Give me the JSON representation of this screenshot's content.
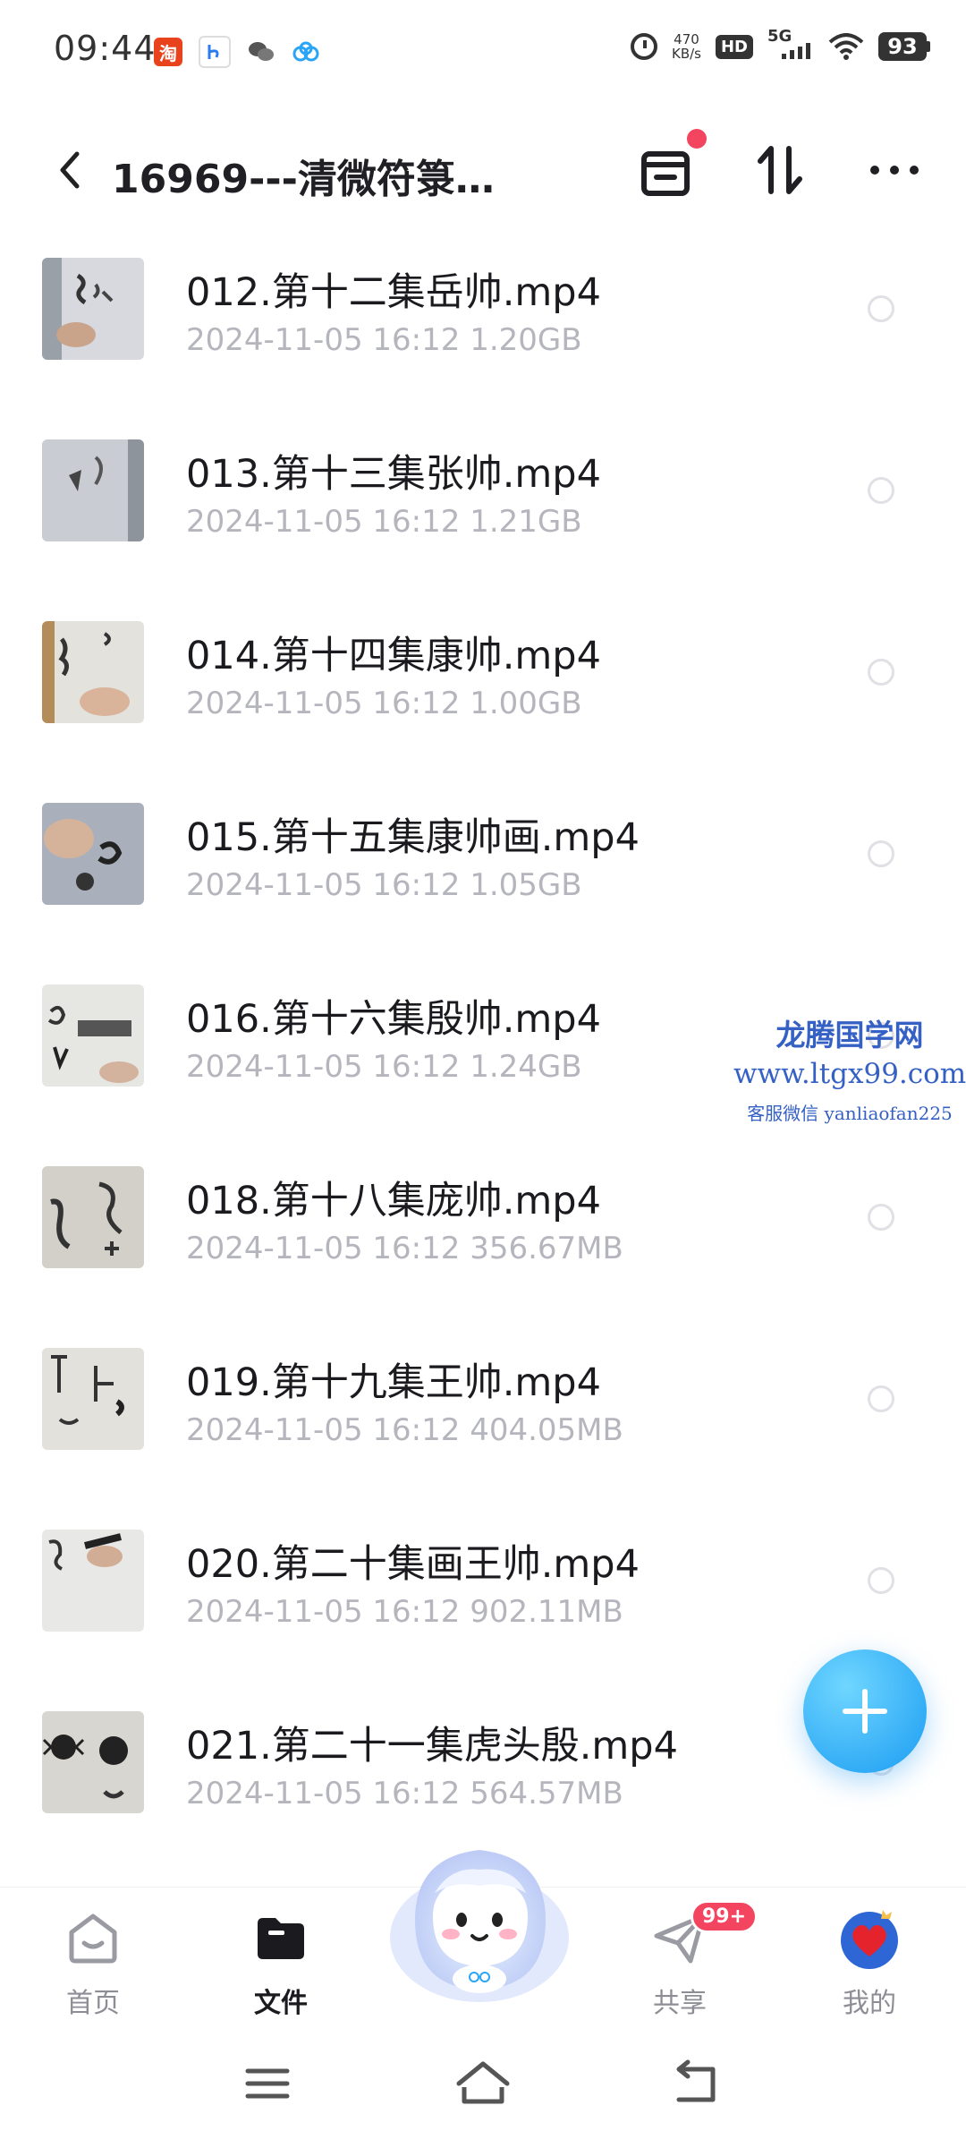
{
  "status_bar": {
    "time": "09:44",
    "net_speed_value": "470",
    "net_speed_unit": "KB/s",
    "hd_label": "HD",
    "network_label": "5G",
    "battery_level": "93",
    "app_icons": [
      "taobao-icon",
      "app-b-icon",
      "wechat-icon",
      "baidu-cloud-icon"
    ]
  },
  "header": {
    "title": "16969---清微符箓…",
    "notification_dot_color": "#f3455f"
  },
  "files": [
    {
      "name": "012.第十二集岳帅.mp4",
      "date": "2024-11-05",
      "time": "16:12",
      "size": "1.20GB"
    },
    {
      "name": "013.第十三集张帅.mp4",
      "date": "2024-11-05",
      "time": "16:12",
      "size": "1.21GB"
    },
    {
      "name": "014.第十四集康帅.mp4",
      "date": "2024-11-05",
      "time": "16:12",
      "size": "1.00GB"
    },
    {
      "name": "015.第十五集康帅画.mp4",
      "date": "2024-11-05",
      "time": "16:12",
      "size": "1.05GB"
    },
    {
      "name": "016.第十六集殷帅.mp4",
      "date": "2024-11-05",
      "time": "16:12",
      "size": "1.24GB"
    },
    {
      "name": "018.第十八集庞帅.mp4",
      "date": "2024-11-05",
      "time": "16:12",
      "size": "356.67MB"
    },
    {
      "name": "019.第十九集王帅.mp4",
      "date": "2024-11-05",
      "time": "16:12",
      "size": "404.05MB"
    },
    {
      "name": "020.第二十集画王帅.mp4",
      "date": "2024-11-05",
      "time": "16:12",
      "size": "902.11MB"
    },
    {
      "name": "021.第二十一集虎头殷.mp4",
      "date": "2024-11-05",
      "time": "16:12",
      "size": "564.57MB"
    }
  ],
  "watermark": {
    "title": "龙腾国学网",
    "url": "www.ltgx99.com",
    "contact": "客服微信 yanliaofan225"
  },
  "bottom_nav": {
    "items": [
      {
        "label": "首页",
        "icon": "home-icon",
        "active": false
      },
      {
        "label": "文件",
        "icon": "folder-icon",
        "active": true
      },
      {
        "label": "共享",
        "icon": "share-plane-icon",
        "active": false,
        "badge": "99+"
      },
      {
        "label": "我的",
        "icon": "avatar-heart-icon",
        "active": false
      }
    ]
  },
  "colors": {
    "accent_blue": "#1b9cf2",
    "badge_red": "#f3455f",
    "meta_gray": "#b5b5bd"
  }
}
